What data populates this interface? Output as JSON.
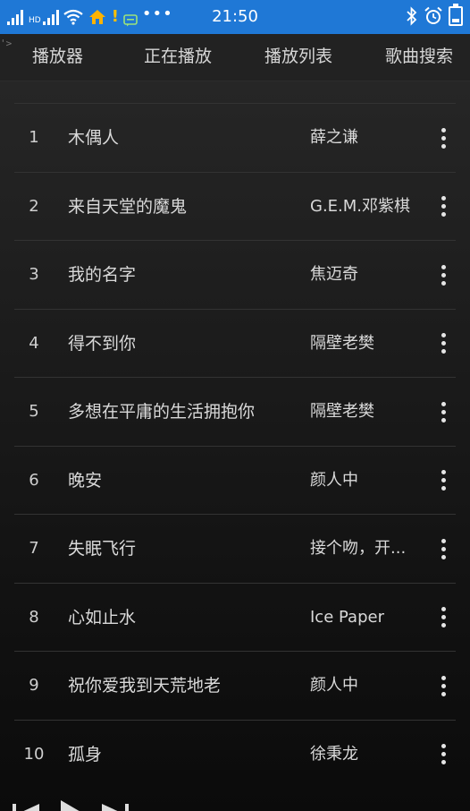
{
  "status_bar": {
    "signal_label": "HD",
    "time": "21:50"
  },
  "header": {
    "back_glyph": "'>",
    "tabs": [
      {
        "label": "播放器"
      },
      {
        "label": "正在播放"
      },
      {
        "label": "播放列表"
      },
      {
        "label": "歌曲搜索"
      }
    ]
  },
  "songs": [
    {
      "number": "1",
      "title": "木偶人",
      "artist": "薛之谦"
    },
    {
      "number": "2",
      "title": "来自天堂的魔鬼",
      "artist": "G.E.M.邓紫棋"
    },
    {
      "number": "3",
      "title": "我的名字",
      "artist": "焦迈奇"
    },
    {
      "number": "4",
      "title": "得不到你",
      "artist": "隔壁老樊"
    },
    {
      "number": "5",
      "title": "多想在平庸的生活拥抱你",
      "artist": "隔壁老樊"
    },
    {
      "number": "6",
      "title": "晚安",
      "artist": "颜人中"
    },
    {
      "number": "7",
      "title": "失眠飞行",
      "artist": "接个吻，开..."
    },
    {
      "number": "8",
      "title": "心如止水",
      "artist": "Ice Paper"
    },
    {
      "number": "9",
      "title": "祝你爱我到天荒地老",
      "artist": "颜人中"
    },
    {
      "number": "10",
      "title": "孤身",
      "artist": "徐秉龙"
    }
  ],
  "icons": {
    "status_left": [
      "signal-icon",
      "signal-icon",
      "wifi-icon",
      "home-icon",
      "notification-icon",
      "message-icon",
      "more-dots-icon"
    ],
    "status_right": [
      "bluetooth-icon",
      "alarm-icon",
      "battery-icon"
    ],
    "row_action": "more-vertical-icon",
    "player": [
      "previous-icon",
      "play-icon",
      "next-icon"
    ]
  },
  "colors": {
    "status_bar_bg": "#1f78d6",
    "header_bg": "#222222",
    "list_bg": "#1c1c1c",
    "text": "#d9d9d9",
    "warning": "#ffc000"
  }
}
